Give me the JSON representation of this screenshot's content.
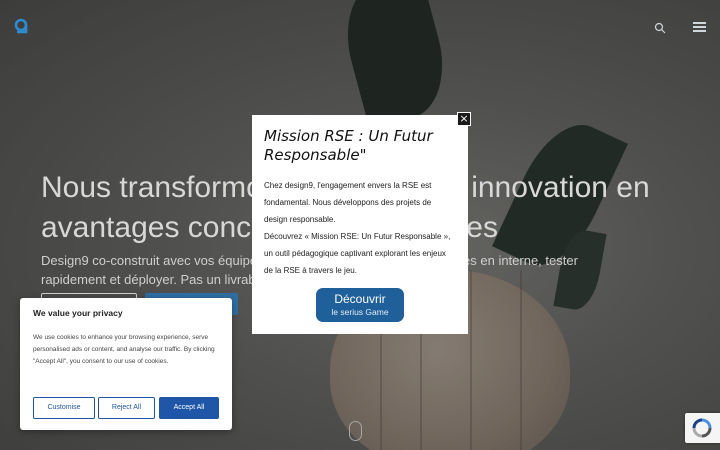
{
  "hero": {
    "title": "Nous transformons vos défis en innovation en avantages concurrentiels durables",
    "subtitle": "Design9 co-construit avec vos équipes des solutions prêtes à être adoptées en interne, tester rapidement et déployer. Pas un livrable. Un résultat."
  },
  "header": {
    "logo_icon": "design9-logo-icon",
    "search_icon": "search-icon",
    "menu_icon": "hamburger-menu-icon"
  },
  "modal": {
    "title": "Mission RSE : Un Futur Responsable\"",
    "paragraph1": "Chez design9, l'engagement envers la RSE est fondamental. Nous développons des projets de design responsable.",
    "paragraph2": "Découvrez « Mission RSE: Un Futur Responsable », un outil pédagogique captivant explorant les enjeux de la RSE à travers le jeu.",
    "button_line1": "Découvrir",
    "button_line2": "le serius Game",
    "close_symbol": "×"
  },
  "cookie": {
    "title": "We value your privacy",
    "text": "We use cookies to enhance your browsing experience, serve personalised ads or content, and analyse our traffic. By clicking \"Accept All\", you consent to our use of cookies.",
    "customise": "Customise",
    "reject": "Reject All",
    "accept": "Accept All"
  },
  "colors": {
    "accent": "#1f56a8",
    "modal_button": "#1f5f9a"
  }
}
